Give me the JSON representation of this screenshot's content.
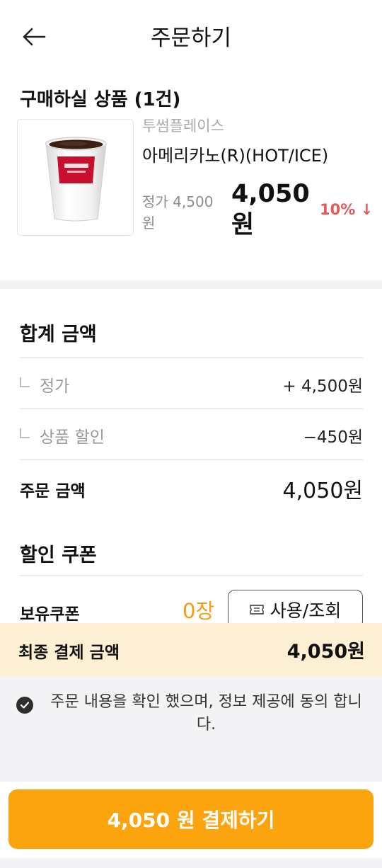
{
  "header": {
    "title": "주문하기"
  },
  "product": {
    "section_title": "구매하실 상품 (1건)",
    "brand": "투썸플레이스",
    "name": "아메리카노(R)(HOT/ICE)",
    "original_price": "정가 4,500 원",
    "sale_price": "4,050 원",
    "discount": "10% ↓",
    "image_icon": "coffee-cup-image"
  },
  "summary": {
    "title": "합계 금액",
    "rows": [
      {
        "label": "정가",
        "value": "+ 4,500원"
      },
      {
        "label": "상품 할인",
        "value": "−450원"
      }
    ],
    "order_label": "주문 금액",
    "order_value": "4,050원"
  },
  "coupon": {
    "title": "할인 쿠폰",
    "held_label": "보유쿠폰",
    "count": "0장",
    "button_label": "사용/조회",
    "button_icon": "ticket-icon"
  },
  "final": {
    "label": "최종 결제 금액",
    "value": "4,050원"
  },
  "agreement": {
    "text": "주문 내용을 확인 했으며, 정보 제공에 동의 합니다.",
    "icon": "check-circle-icon"
  },
  "footer": {
    "pay_button_label": "4,050 원 결제하기"
  },
  "colors": {
    "accent": "#fca40e",
    "coupon_count": "#f29d12",
    "discount": "#e15a5a",
    "final_bar": "#fdefd3",
    "band": "#f3f3f5"
  }
}
